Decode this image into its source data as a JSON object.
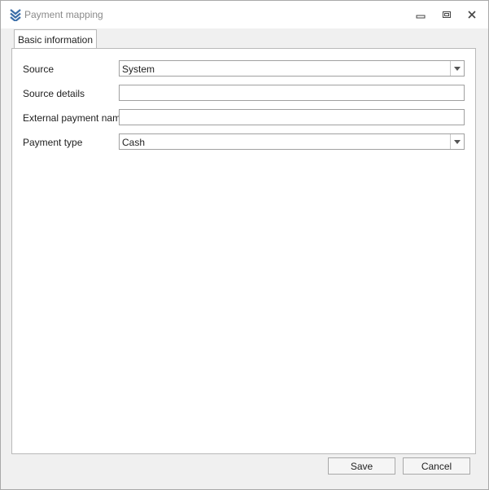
{
  "window": {
    "title": "Payment mapping",
    "app_icon": "chevrons-down-icon",
    "controls": [
      "minimize-icon",
      "restore-icon",
      "close-icon"
    ]
  },
  "tabs": [
    {
      "label": "Basic information",
      "selected": true
    }
  ],
  "form": {
    "source": {
      "label": "Source",
      "value": "System",
      "type": "dropdown"
    },
    "source_details": {
      "label": "Source details",
      "value": ""
    },
    "external_payment_name": {
      "label": "External payment name",
      "value": ""
    },
    "payment_type": {
      "label": "Payment type",
      "value": "Cash",
      "type": "dropdown"
    }
  },
  "buttons": {
    "save": "Save",
    "cancel": "Cancel"
  },
  "colors": {
    "accent": "#3b6ea8",
    "border": "#a0a0a0",
    "title_text": "#8a8a8a"
  }
}
